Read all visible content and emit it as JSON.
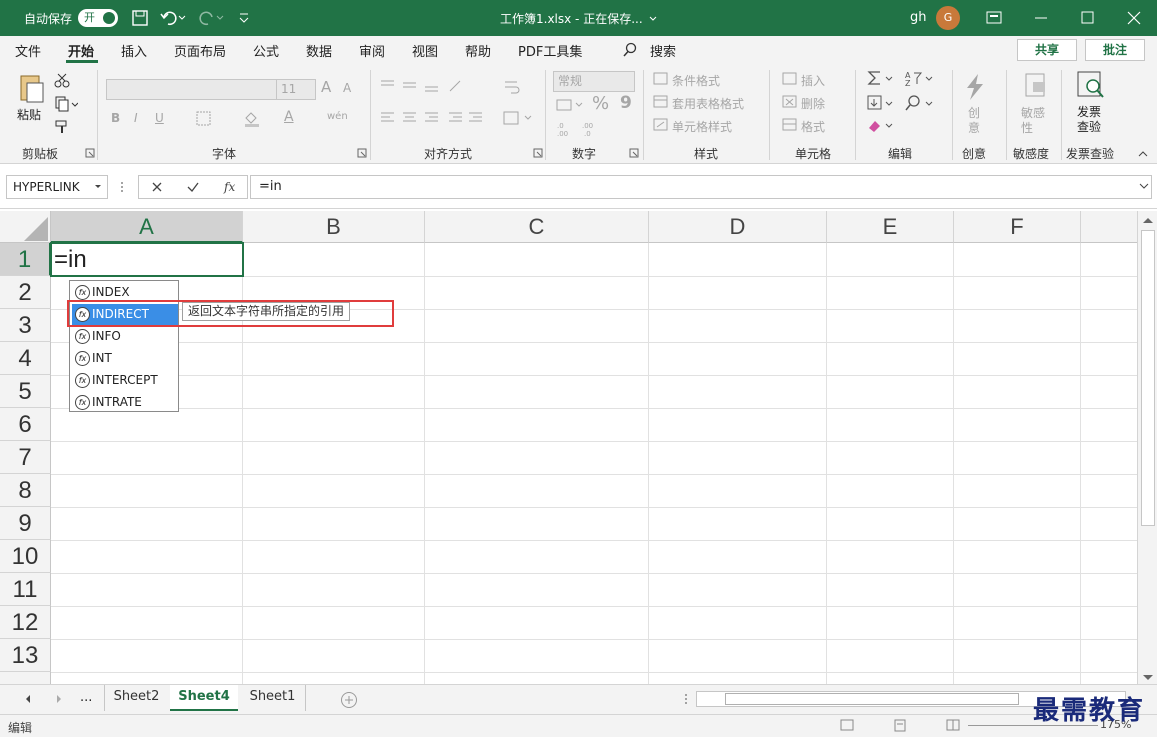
{
  "titlebar": {
    "autosave_label": "自动保存",
    "autosave_state": "开",
    "title": "工作簿1.xlsx  -  正在保存...",
    "user": "gh",
    "avatar_letter": "G",
    "accent": "#217346"
  },
  "menu": {
    "items": [
      "文件",
      "开始",
      "插入",
      "页面布局",
      "公式",
      "数据",
      "审阅",
      "视图",
      "帮助",
      "PDF工具集"
    ],
    "search": "搜索",
    "share": "共享",
    "comment": "批注"
  },
  "ribbon": {
    "clipboard": {
      "paste": "粘贴",
      "label": "剪贴板"
    },
    "font": {
      "bold": "B",
      "italic": "I",
      "underline": "U",
      "grow": "A",
      "shrink": "A",
      "wen": "wén",
      "label": "字体",
      "size": "11"
    },
    "align": {
      "label": "对齐方式"
    },
    "number": {
      "format": "常规",
      "percent": "%",
      "comma": "9",
      "label": "数字"
    },
    "styles": {
      "cond": "条件格式",
      "table": "套用表格格式",
      "cell": "单元格样式",
      "label": "样式"
    },
    "cells": {
      "insert": "插入",
      "delete": "删除",
      "format": "格式",
      "label": "单元格"
    },
    "edit": {
      "label": "编辑"
    },
    "create": {
      "btn": "创意",
      "label": "创意"
    },
    "sens": {
      "btn": "敏感性",
      "label": "敏感度"
    },
    "invoice": {
      "btn": "发票查验",
      "label": "发票查验"
    }
  },
  "formula": {
    "namebox": "HYPERLINK",
    "value": "=in"
  },
  "grid": {
    "columns": [
      "A",
      "B",
      "C",
      "D",
      "E",
      "F"
    ],
    "rows": [
      "1",
      "2",
      "3",
      "4",
      "5",
      "6",
      "7",
      "8",
      "9",
      "10",
      "11",
      "12",
      "13"
    ],
    "cell_a1": "=in"
  },
  "autocomplete": {
    "items": [
      "INDEX",
      "INDIRECT",
      "INFO",
      "INT",
      "INTERCEPT",
      "INTRATE"
    ],
    "selected": "INDIRECT",
    "tooltip": "返回文本字符串所指定的引用"
  },
  "tabs": {
    "more": "...",
    "sheets": [
      "Sheet2",
      "Sheet4",
      "Sheet1"
    ],
    "active": "Sheet4"
  },
  "status": {
    "mode": "编辑",
    "zoom": "175%"
  },
  "watermark": "最需教育"
}
